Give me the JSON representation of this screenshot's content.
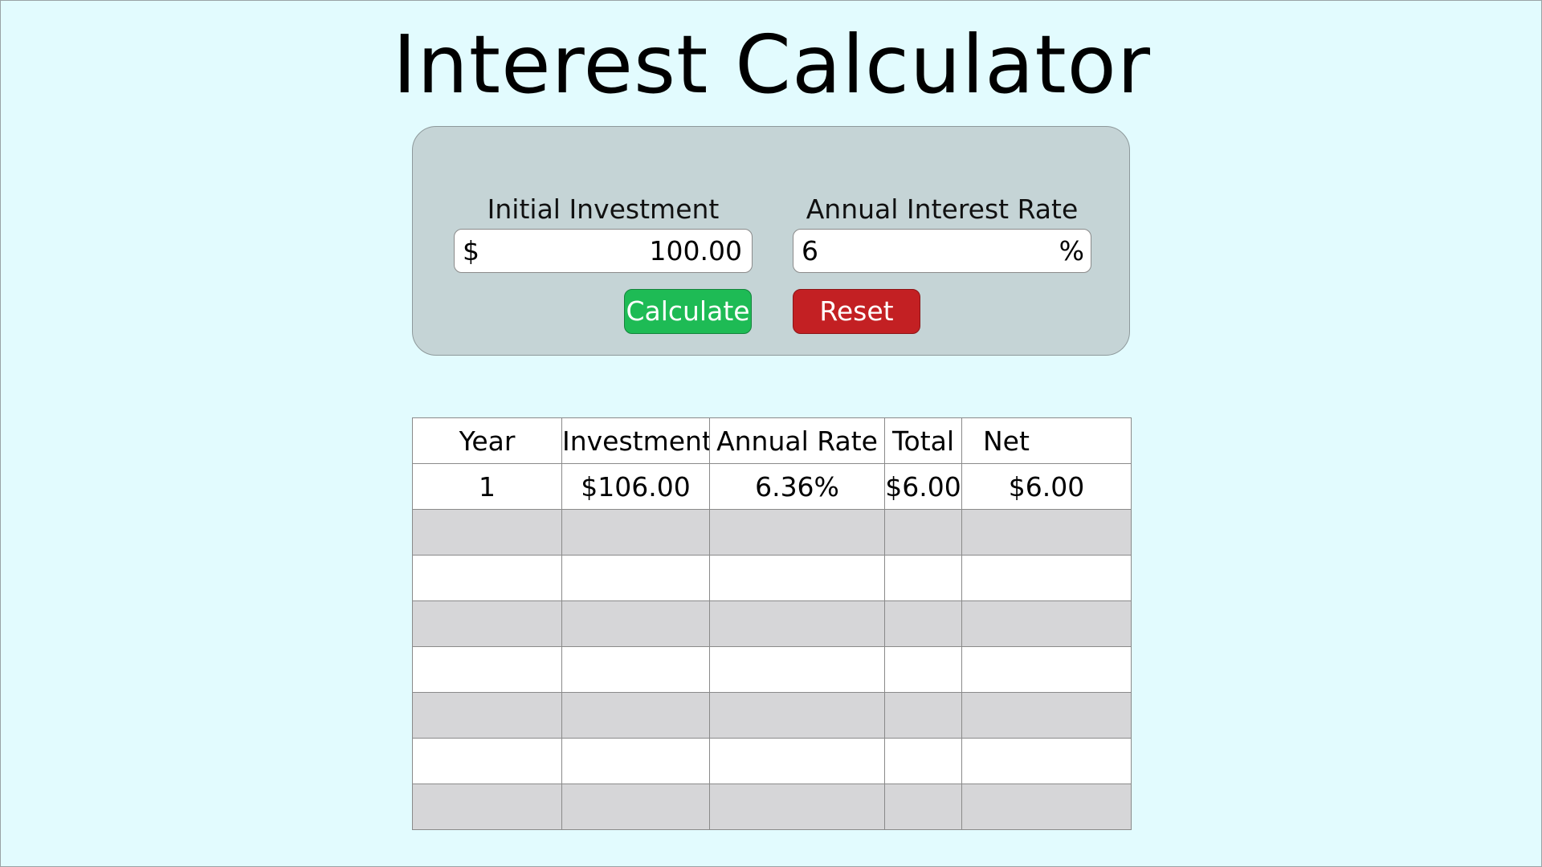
{
  "page": {
    "title": "Interest Calculator"
  },
  "form": {
    "investment_label": "Initial Investment",
    "investment_prefix": "$",
    "investment_value": "100.00",
    "rate_label": "Annual Interest Rate",
    "rate_value": "6",
    "rate_suffix": "%",
    "calculate_label": "Calculate",
    "reset_label": "Reset"
  },
  "table": {
    "headers": [
      "Year",
      "Investment",
      "Annual Rate",
      "Total",
      "Net"
    ],
    "rows": [
      [
        "1",
        "$106.00",
        "6.36%",
        "$6.00",
        "$6.00"
      ]
    ]
  },
  "colors": {
    "background": "#e2fbfe",
    "panel": "#c5d4d6",
    "calculate_button": "#1ebb55",
    "reset_button": "#c32023",
    "shaded_row": "#d6d6d8"
  }
}
